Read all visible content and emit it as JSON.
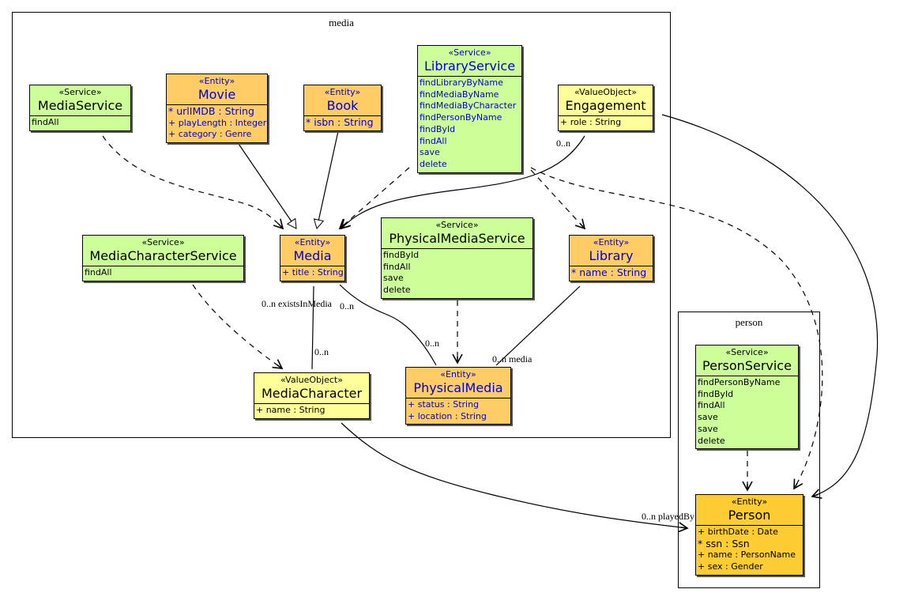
{
  "packages": {
    "media": {
      "label": "media"
    },
    "person": {
      "label": "person"
    }
  },
  "classes": {
    "MediaService": {
      "stereotype": "«Service»",
      "name": "MediaService",
      "members": [
        "findAll"
      ]
    },
    "Movie": {
      "stereotype": "«Entity»",
      "name": "Movie",
      "members": [
        "* urlIMDB : String",
        "+ playLength : Integer",
        "+ category : Genre"
      ]
    },
    "Book": {
      "stereotype": "«Entity»",
      "name": "Book",
      "members": [
        "* isbn : String"
      ]
    },
    "LibraryService": {
      "stereotype": "«Service»",
      "name": "LibraryService",
      "members": [
        "findLibraryByName",
        "findMediaByName",
        "findMediaByCharacter",
        "findPersonByName",
        "findById",
        "findAll",
        "save",
        "delete"
      ]
    },
    "Engagement": {
      "stereotype": "«ValueObject»",
      "name": "Engagement",
      "members": [
        "+ role : String"
      ]
    },
    "MediaCharacterService": {
      "stereotype": "«Service»",
      "name": "MediaCharacterService",
      "members": [
        "findAll"
      ]
    },
    "Media": {
      "stereotype": "«Entity»",
      "name": "Media",
      "members": [
        "+ title : String"
      ]
    },
    "PhysicalMediaService": {
      "stereotype": "«Service»",
      "name": "PhysicalMediaService",
      "members": [
        "findById",
        "findAll",
        "save",
        "delete"
      ]
    },
    "Library": {
      "stereotype": "«Entity»",
      "name": "Library",
      "members": [
        "* name : String"
      ]
    },
    "MediaCharacter": {
      "stereotype": "«ValueObject»",
      "name": "MediaCharacter",
      "members": [
        "+ name : String"
      ]
    },
    "PhysicalMedia": {
      "stereotype": "«Entity»",
      "name": "PhysicalMedia",
      "members": [
        "+ status : String",
        "+ location : String"
      ]
    },
    "PersonService": {
      "stereotype": "«Service»",
      "name": "PersonService",
      "members": [
        "findPersonByName",
        "findById",
        "findAll",
        "save",
        "save",
        "delete"
      ]
    },
    "Person": {
      "stereotype": "«Entity»",
      "name": "Person",
      "members": [
        "+ birthDate : Date",
        "* ssn : Ssn",
        "+ name : PersonName",
        "+ sex : Gender"
      ]
    }
  },
  "edge_labels": {
    "engagement_mult": "0..n",
    "existsInMedia": "0..n existsInMedia",
    "media_physical_mult": "0..n",
    "character_mult": "0..n",
    "physical_mult": "0..n",
    "library_media": "0..n media",
    "playedBy": "0..n playedBy"
  },
  "colors": {
    "service": "#ccff99",
    "entity": "#ffcc66",
    "entity_root": "#ffcc33",
    "value_object": "#ffff99",
    "domain_text": "#0000cc"
  }
}
